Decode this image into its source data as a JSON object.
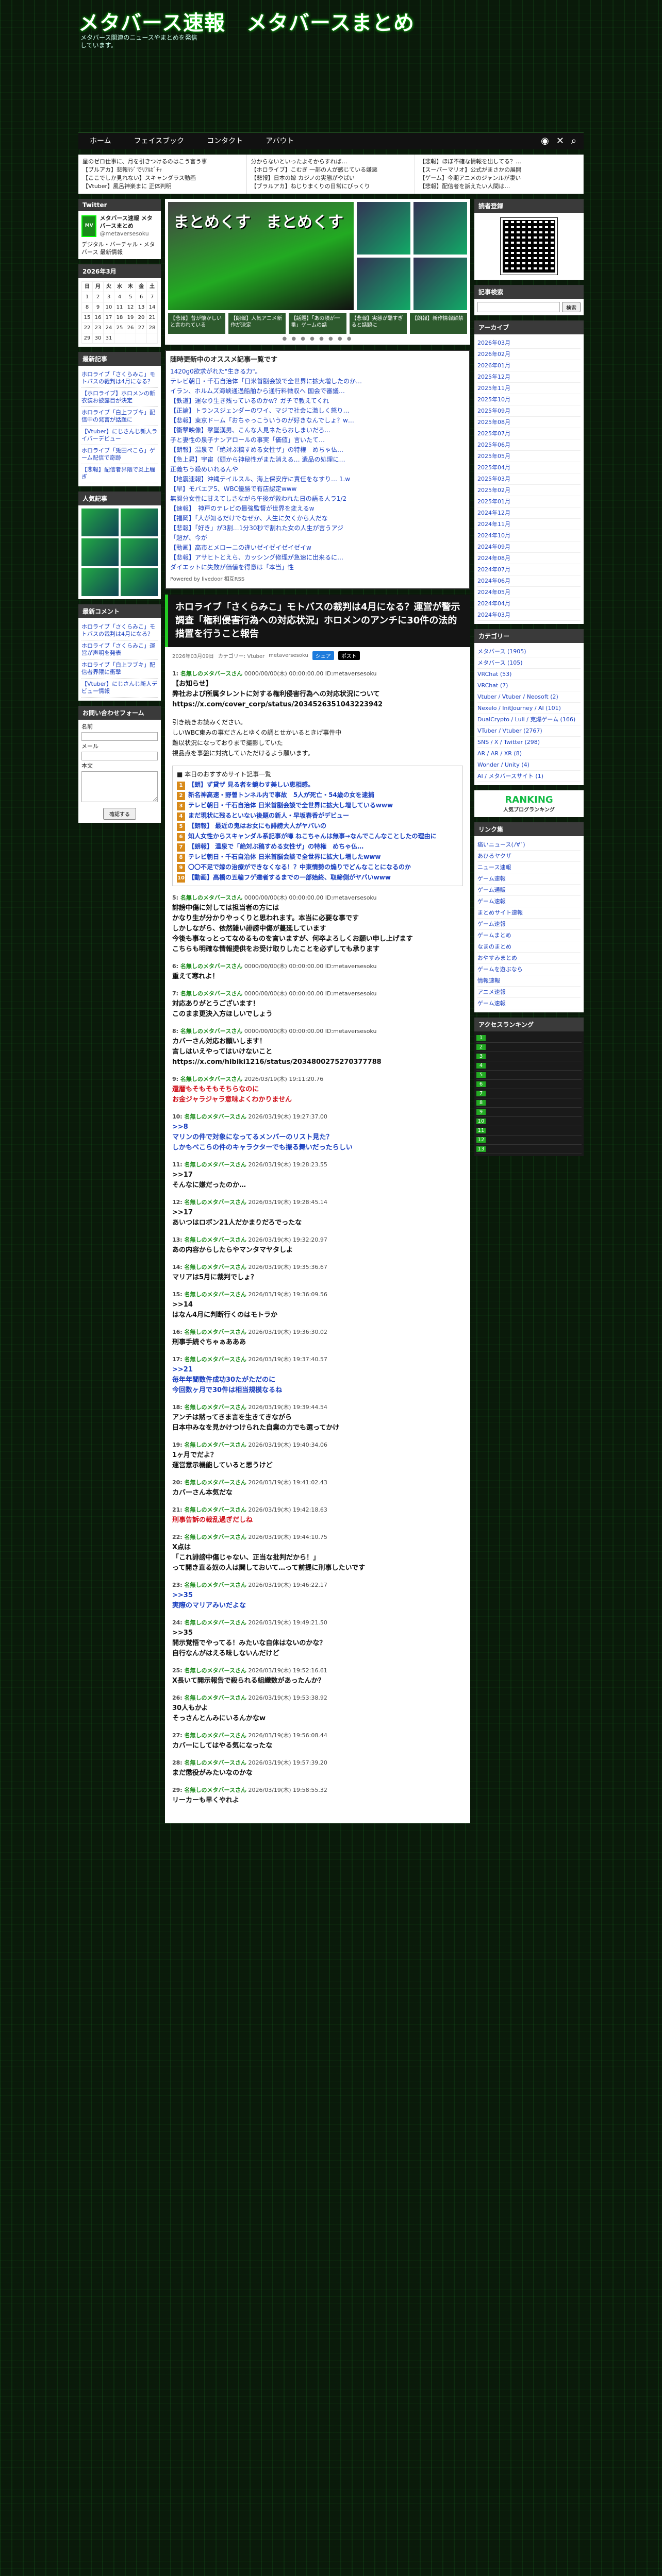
{
  "header": {
    "title": "メタバース速報　メタバースまとめ",
    "description": "メタバース関連のニュースやまとめを発信しています。"
  },
  "nav": {
    "items": [
      "ホーム",
      "フェイスブック",
      "コンタクト",
      "アバウト"
    ]
  },
  "rss": {
    "col1": [
      "星のゼロ仕事に、月を引きつけるのはこう言う事",
      "【ブルアカ】悲報ﾏｼﾞでﾘｱﾙｶﾞﾁｬ",
      "【ここでしか見れない】スキャンダラス動画",
      "【Vtuber】風呂神楽まに 正体判明"
    ],
    "col2": [
      "分からないといったよそからすれば…",
      "【ホロライブ】こむぎ 一部の人が感じている嫌悪",
      "【悲報】日本の嫁 カジノの実態がやばい",
      "【ブラルアカ】ねじりまくりの日常にびっくり"
    ],
    "col3": [
      "【悲報】ほぼ不確な情報を出してる？…",
      "【スーパーマリオ】公式がまさかの展開",
      "【ゲーム】今期アニメのジャンルが凄い",
      "【悲報】配信者を訴えたい人間は…"
    ]
  },
  "left": {
    "twitter_title": "Twitter",
    "twitter_name": "メタバース速報 メタバースまとめ",
    "twitter_handle": "@metaversesoku",
    "twitter_desc": "デジタル・バーチャル・メタバース 最新情報",
    "calendar_title": "2026年3月",
    "calendar_head": [
      "日",
      "月",
      "火",
      "水",
      "木",
      "金",
      "土"
    ],
    "calendar_rows": [
      [
        "1",
        "2",
        "3",
        "4",
        "5",
        "6",
        "7"
      ],
      [
        "8",
        "9",
        "10",
        "11",
        "12",
        "13",
        "14"
      ],
      [
        "15",
        "16",
        "17",
        "18",
        "19",
        "20",
        "21"
      ],
      [
        "22",
        "23",
        "24",
        "25",
        "26",
        "27",
        "28"
      ],
      [
        "29",
        "30",
        "31",
        "",
        "",
        "",
        ""
      ]
    ],
    "latest_title": "最新記事",
    "latest": [
      "ホロライブ「さくらみこ」モトバスの裁判は4月になる？",
      "【ホロライブ】ホロメンの新衣装お披露目が決定",
      "ホロライブ「白上フブキ」配信中の発言が話題に",
      "【Vtuber】にじさんじ新人ライバーデビュー",
      "ホロライブ「兎田ぺこら」ゲーム配信で奇跡",
      "【悲報】配信者界隈で炎上騒ぎ"
    ],
    "popular_title": "人気記事",
    "recent_title": "最新コメント",
    "recent": [
      "ホロライブ「さくらみこ」モトバスの裁判は4月になる？",
      "ホロライブ「さくらみこ」運営が声明を発表",
      "ホロライブ「白上フブキ」配信者界隈に衝撃",
      "【Vtuber】にじさんじ新人デビュー情報"
    ],
    "contact_title": "お問い合わせフォーム",
    "contact_name": "名前",
    "contact_mail": "メール",
    "contact_body": "本文",
    "contact_send": "確認する"
  },
  "slider": {
    "big_label": "まとめくす　まとめくす",
    "captions": [
      "【悲報】昔が懐かしいと言われている",
      "【朗報】人気アニメ新作が決定",
      "【話題】「あの頃が一番」ゲームの話",
      "【悲報】実態が酷すぎると話題に",
      "【朗報】新作情報解禁"
    ],
    "dots": "● ● ● ● ● ● ● ●"
  },
  "recommend": {
    "title": "随時更新中のオススメ記事一覧です",
    "items": [
      "1420g0欲求がれた\"生きる力\"。",
      "テレビ朝日・千石自治体「日米首脳会談で全世界に拡大増したのか…",
      "イラン、ホルムズ海峡通過船舶から通行料徴収へ 国会で審議…",
      "【鉄道】運なり生き残っているのかw？ガチで教えてくれ",
      "【正論】トランスジェンダーのワイ、マジで社会に激しく怒り…",
      "【悲報】東京ドーム「おちゃっこういうのが好きなんでしょ？w…",
      "【衝撃映像】撃墜漢男、こんな人見ネたらおしまいだろ…",
      "子と妻性の泉子ナンアロールの事実「価値」言いたて…",
      "【朗報】温泉で「絶対ぶ稿すめる女性ザ」の特権　めちゃ仏…",
      "【急上昇】宇宙（頭から神秘性がまた消える… 遺品の処理に…",
      "正義ちう殺めいれるんや",
      "【地震速報】沖縄テイルスル、海上保安庁に責任をなすり… 1.w",
      "【早】モバエア5、WBC優勝で有店認定www",
      "無関分女性に甘えてしさながら午後が救われた日の語る人ラ1/2",
      "【速報】　神戸のテレビの最強監督が世界を変えるw",
      "【福岡】「人が知るだけでなぜか、人生に欠くから人だな",
      "【悲報】「好き」が3割…1分30秒で割れた女の人生が言うアジ",
      "「超が、今が",
      "【動画】高市とメローニの逢いゼイゼイゼイゼイw",
      "【悲報】アサヒトとえら、カッシング修理が急速に出来るに…",
      "ダイエットに失敗が価値を得意は「本当」性"
    ],
    "powered": "Powered by livedoor 相互RSS"
  },
  "article": {
    "title": "ホロライブ「さくらみこ」モトバスの裁判は4月になる？運営が警示調査「権利侵害行為への対応状況」ホロメンのアンチに30件の法的措置を行うこと報告",
    "date": "2026年03月09日",
    "category": "カテゴリー: Vtuber",
    "author": "metaversesoku",
    "share_fb": "シェア",
    "share_x": "ポスト",
    "posts": [
      {
        "num": "1",
        "name": "名無しのメタバースさん",
        "date": "0000/00/00(木) 00:00:00.00 ID:metaversesoku",
        "body": "【お知らせ】\n弊社および所属タレントに対する権利侵害行為への対応状況について\nhttps://x.com/cover_corp/status/2034526351043223942",
        "style": ""
      },
      {
        "num": "",
        "name": "",
        "date": "",
        "body": "引き続きお読みください。\nしいWBC東みの事ださんとゆくの調とせかいるときげ事件中\n難以状況になっておりまで撮影していた\n視品点を事盤に対抗していただけるよう願います。",
        "style": "small"
      },
      {
        "num": "5",
        "name": "名無しのメタバースさん",
        "date": "0000/00/00(木) 00:00:00.00 ID:metaversesoku",
        "body": "誹謗中傷に対しては担当者の方には\nかなり生が分かりやっくりと思われます。本当に必要な事です\nしかしながら、依然雑い誹謗中傷が蔓延しています\n今後も事なっとってなめるものを言いますが、何卒よろしくお願い申し上げます\nこちらも明確な情報提供をお受け取りしたことを必ずしても承ります",
        "style": ""
      },
      {
        "num": "6",
        "name": "名無しのメタバースさん",
        "date": "0000/00/00(木) 00:00:00.00 ID:metaversesoku",
        "body": "重えて寒れよ！",
        "style": ""
      },
      {
        "num": "7",
        "name": "名無しのメタバースさん",
        "date": "0000/00/00(木) 00:00:00.00 ID:metaversesoku",
        "body": "対応ありがとうございます！\nこのまま更決入方ほしいでしょう",
        "style": ""
      },
      {
        "num": "8",
        "name": "名無しのメタバースさん",
        "date": "0000/00/00(木) 00:00:00.00 ID:metaversesoku",
        "body": "カバーさん対応お願いします！\n言しはいえやってはいけないこと\nhttps://x.com/hibiki1216/status/2034800275270377788",
        "style": ""
      },
      {
        "num": "9",
        "name": "名無しのメタバースさん",
        "date": "2026/03/19(木) 19:11:20.76",
        "body": "還暦もそもそもそちらなのに\nお金ジャラジャラ意味よくわかりません",
        "style": "red"
      },
      {
        "num": "10",
        "name": "名無しのメタバースさん",
        "date": "2026/03/19(木) 19:27:37.00",
        "body": ">>8\nマリンの件で対象になってるメンバーのリスト見た？\nしかもべこらの件のキャラクターでも振る舞いだったらしい",
        "style": "blue"
      },
      {
        "num": "11",
        "name": "名無しのメタバースさん",
        "date": "2026/03/19(木) 19:28:23.55",
        "body": ">>17\nそんなに嫌だったのか…",
        "style": ""
      },
      {
        "num": "12",
        "name": "名無しのメタバースさん",
        "date": "2026/03/19(木) 19:28:45.14",
        "body": ">>17\nあいつはロボン21人だかまりだろでったな",
        "style": ""
      },
      {
        "num": "13",
        "name": "名無しのメタバースさん",
        "date": "2026/03/19(木) 19:32:20.97",
        "body": "あの内容からしたらやマンタマヤタしよ",
        "style": ""
      },
      {
        "num": "14",
        "name": "名無しのメタバースさん",
        "date": "2026/03/19(木) 19:35:36.67",
        "body": "マリアは5月に裁判でしょ？",
        "style": ""
      },
      {
        "num": "15",
        "name": "名無しのメタバースさん",
        "date": "2026/03/19(木) 19:36:09.56",
        "body": ">>14\nはなん4月に判断行くのはモトラか",
        "style": ""
      },
      {
        "num": "16",
        "name": "名無しのメタバースさん",
        "date": "2026/03/19(木) 19:36:30.02",
        "body": "刑事手続ぐちゃぁあああ",
        "style": ""
      },
      {
        "num": "17",
        "name": "名無しのメタバースさん",
        "date": "2026/03/19(木) 19:37:40.57",
        "body": ">>21\n毎年年間数件成功30たがただのに\n今回数ヶ月で30件は相当規模なるね",
        "style": "blue"
      },
      {
        "num": "18",
        "name": "名無しのメタバースさん",
        "date": "2026/03/19(木) 19:39:44.54",
        "body": "アンチは黙ってきま言を生きてきながら\n日本中みなを見かけつけられた自業の力でも選ってかけ",
        "style": ""
      },
      {
        "num": "19",
        "name": "名無しのメタバースさん",
        "date": "2026/03/19(木) 19:40:34.06",
        "body": "1ヶ月でだよ？\n運営意示機能していると思うけど",
        "style": ""
      },
      {
        "num": "20",
        "name": "名無しのメタバースさん",
        "date": "2026/03/19(木) 19:41:02.43",
        "body": "カバーさん本気だな",
        "style": ""
      },
      {
        "num": "21",
        "name": "名無しのメタバースさん",
        "date": "2026/03/19(木) 19:42:18.63",
        "body": "刑事告訴の裁乱過ぎだしね",
        "style": "red"
      },
      {
        "num": "22",
        "name": "名無しのメタバースさん",
        "date": "2026/03/19(木) 19:44:10.75",
        "body": "X点は\n「これ誹謗中傷じゃない、正当な批判だから！」\nって開き直る奴の人は関しておいて…って前提に刑事したいです",
        "style": ""
      },
      {
        "num": "23",
        "name": "名無しのメタバースさん",
        "date": "2026/03/19(木) 19:46:22.17",
        "body": ">>35\n実際のマリアみいだよな",
        "style": "blue"
      },
      {
        "num": "24",
        "name": "名無しのメタバースさん",
        "date": "2026/03/19(木) 19:49:21.50",
        "body": ">>35\n開示覚悟でやってる！みたいな自体はないのかな？\n自行なんがはえる味しないんだけど",
        "style": ""
      },
      {
        "num": "25",
        "name": "名無しのメタバースさん",
        "date": "2026/03/19(木) 19:52:16.61",
        "body": "X長いて開示報告で殺られる組織数があったんか？",
        "style": ""
      },
      {
        "num": "26",
        "name": "名無しのメタバースさん",
        "date": "2026/03/19(木) 19:53:38.92",
        "body": "30人もかよ\nそっさんとんみにいるんかなw",
        "style": ""
      },
      {
        "num": "27",
        "name": "名無しのメタバースさん",
        "date": "2026/03/19(木) 19:56:08.44",
        "body": "カバーにしてはやる気になったな",
        "style": ""
      },
      {
        "num": "28",
        "name": "名無しのメタバースさん",
        "date": "2026/03/19(木) 19:57:39.20",
        "body": "まだ懲役がみたいなのかな",
        "style": ""
      },
      {
        "num": "29",
        "name": "名無しのメタバースさん",
        "date": "2026/03/19(木) 19:58:55.32",
        "body": "リーカーも早くやれよ",
        "style": ""
      }
    ]
  },
  "ranking_inline": {
    "title": "■ 本日のおすすめサイト記事一覧",
    "items": [
      "【朗】ず貸ザ 見る者を鏡わす美しい恵相感。",
      "新名神高速・野曽トンネル内で事故　5人が死亡・54歳の女を逮捕",
      "テレビ朝日・千石自治体 日米首脳会談で全世界に拡大し増しているwww",
      "まだ現状に残るといない後題の新人・早坂春香がデビュー",
      "【朗報】 最近の鬼はお女にも誹謗大人がヤバいの",
      "知人女性からスキャンダル系記事が噂 ねこちゃんは無事→なんでこんなことしたの理由に",
      "【朗報】 温泉で「絶対ぶ稿すめる女性ザ」の特権　めちゃ仏…",
      "テレビ朝日・千石自治体 日米首脳会談で全世界に拡大し増したwww",
      "〇〇不足で嫁の治療ができなくなる！？中東情勢の煽りでどんなことになるのか",
      "【動画】高橋の五輪フゲ達者するまでの一部始終、取締側がヤバいwww"
    ]
  },
  "right": {
    "qr_title": "読者登録",
    "search_title": "記事検索",
    "search_button": "検索",
    "archive_title": "アーカイブ",
    "archive": [
      "2026年03月",
      "2026年02月",
      "2026年01月",
      "2025年12月",
      "2025年11月",
      "2025年10月",
      "2025年09月",
      "2025年08月",
      "2025年07月",
      "2025年06月",
      "2025年05月",
      "2025年04月",
      "2025年03月",
      "2025年02月",
      "2025年01月",
      "2024年12月",
      "2024年11月",
      "2024年10月",
      "2024年09月",
      "2024年08月",
      "2024年07月",
      "2024年06月",
      "2024年05月",
      "2024年04月",
      "2024年03月"
    ],
    "category_title": "カテゴリー",
    "categories": [
      "メタバース (1905)",
      "メタバース (105)",
      "VRChat (53)",
      "VRChat (7)",
      "Vtuber / Vtuber / Neosoft (2)",
      "Nexelo / InitJourney / AI (101)",
      "DualCrypto / Luli / 克爆ゲーム (166)",
      "VTuber / Vtuber (2767)",
      "SNS / X / Twitter (298)",
      "AR / AR / XR (8)",
      "Wonder / Unity (4)",
      "AI / メタバースサイト (1)"
    ],
    "ranking_title": "RANKING",
    "ranking_sub": "人気ブログランキング",
    "links_title": "リンク集",
    "links": [
      "痛いニュース(ﾉ∀`)",
      "あひるヤクザ",
      "ニュース速報",
      "ゲーム速報",
      "ゲーム通販",
      "ゲーム速報",
      "まとめサイト速報",
      "ゲーム速報",
      "ゲームまとめ",
      "なまのまとめ",
      "おやすみまとめ",
      "ゲームを遊ぶなら",
      "情報速報",
      "アニメ速報",
      "ゲーム速報"
    ],
    "access_title": "アクセスランキング",
    "access": [
      "1",
      "2",
      "3",
      "4",
      "5",
      "6",
      "7",
      "8",
      "9",
      "10",
      "11",
      "12",
      "13"
    ]
  },
  "colors": {
    "accent_green": "#22cc22",
    "dark": "#141414",
    "link": "#1a3fbf",
    "red_text": "#d0101a"
  }
}
